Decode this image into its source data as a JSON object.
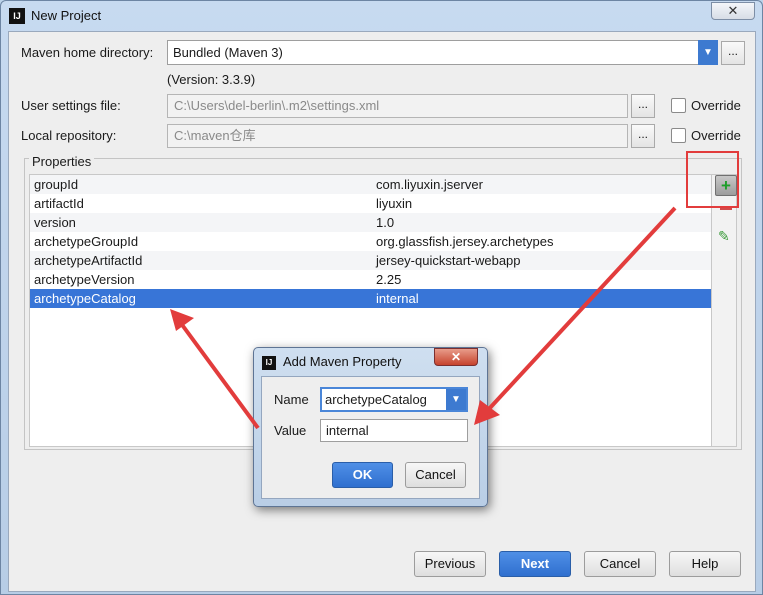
{
  "window": {
    "title": "New Project",
    "close_symbol": "✕"
  },
  "maven_home": {
    "label": "Maven home directory:",
    "value": "Bundled (Maven 3)",
    "version": "(Version: 3.3.9)"
  },
  "user_settings": {
    "label": "User settings file:",
    "value": "C:\\Users\\del-berlin\\.m2\\settings.xml",
    "override_label": "Override",
    "override_checked": false
  },
  "local_repository": {
    "label": "Local repository:",
    "value": "C:\\maven仓库",
    "override_label": "Override",
    "override_checked": false
  },
  "browse_symbol": "...",
  "properties": {
    "group_label": "Properties",
    "rows": [
      {
        "key": "groupId",
        "value": "com.liyuxin.jserver"
      },
      {
        "key": "artifactId",
        "value": "liyuxin"
      },
      {
        "key": "version",
        "value": "1.0"
      },
      {
        "key": "archetypeGroupId",
        "value": "org.glassfish.jersey.archetypes"
      },
      {
        "key": "archetypeArtifactId",
        "value": "jersey-quickstart-webapp"
      },
      {
        "key": "archetypeVersion",
        "value": "2.25"
      },
      {
        "key": "archetypeCatalog",
        "value": "internal",
        "selected": true
      }
    ],
    "tools": {
      "add_icon": "plus-icon",
      "remove_icon": "minus-icon",
      "edit_icon": "pencil-icon",
      "add_symbol": "+",
      "edit_symbol": "✎"
    }
  },
  "dialog": {
    "title": "Add Maven Property",
    "close_symbol": "✕",
    "name_label": "Name",
    "name_value": "archetypeCatalog",
    "value_label": "Value",
    "value_value": "internal",
    "ok_label": "OK",
    "cancel_label": "Cancel"
  },
  "footer": {
    "previous_label": "Previous",
    "next_label": "Next",
    "cancel_label": "Cancel",
    "help_label": "Help"
  },
  "colors": {
    "accent": "#3875d7",
    "annotation": "#e23c3c",
    "add_icon": "#1e9e2a"
  }
}
